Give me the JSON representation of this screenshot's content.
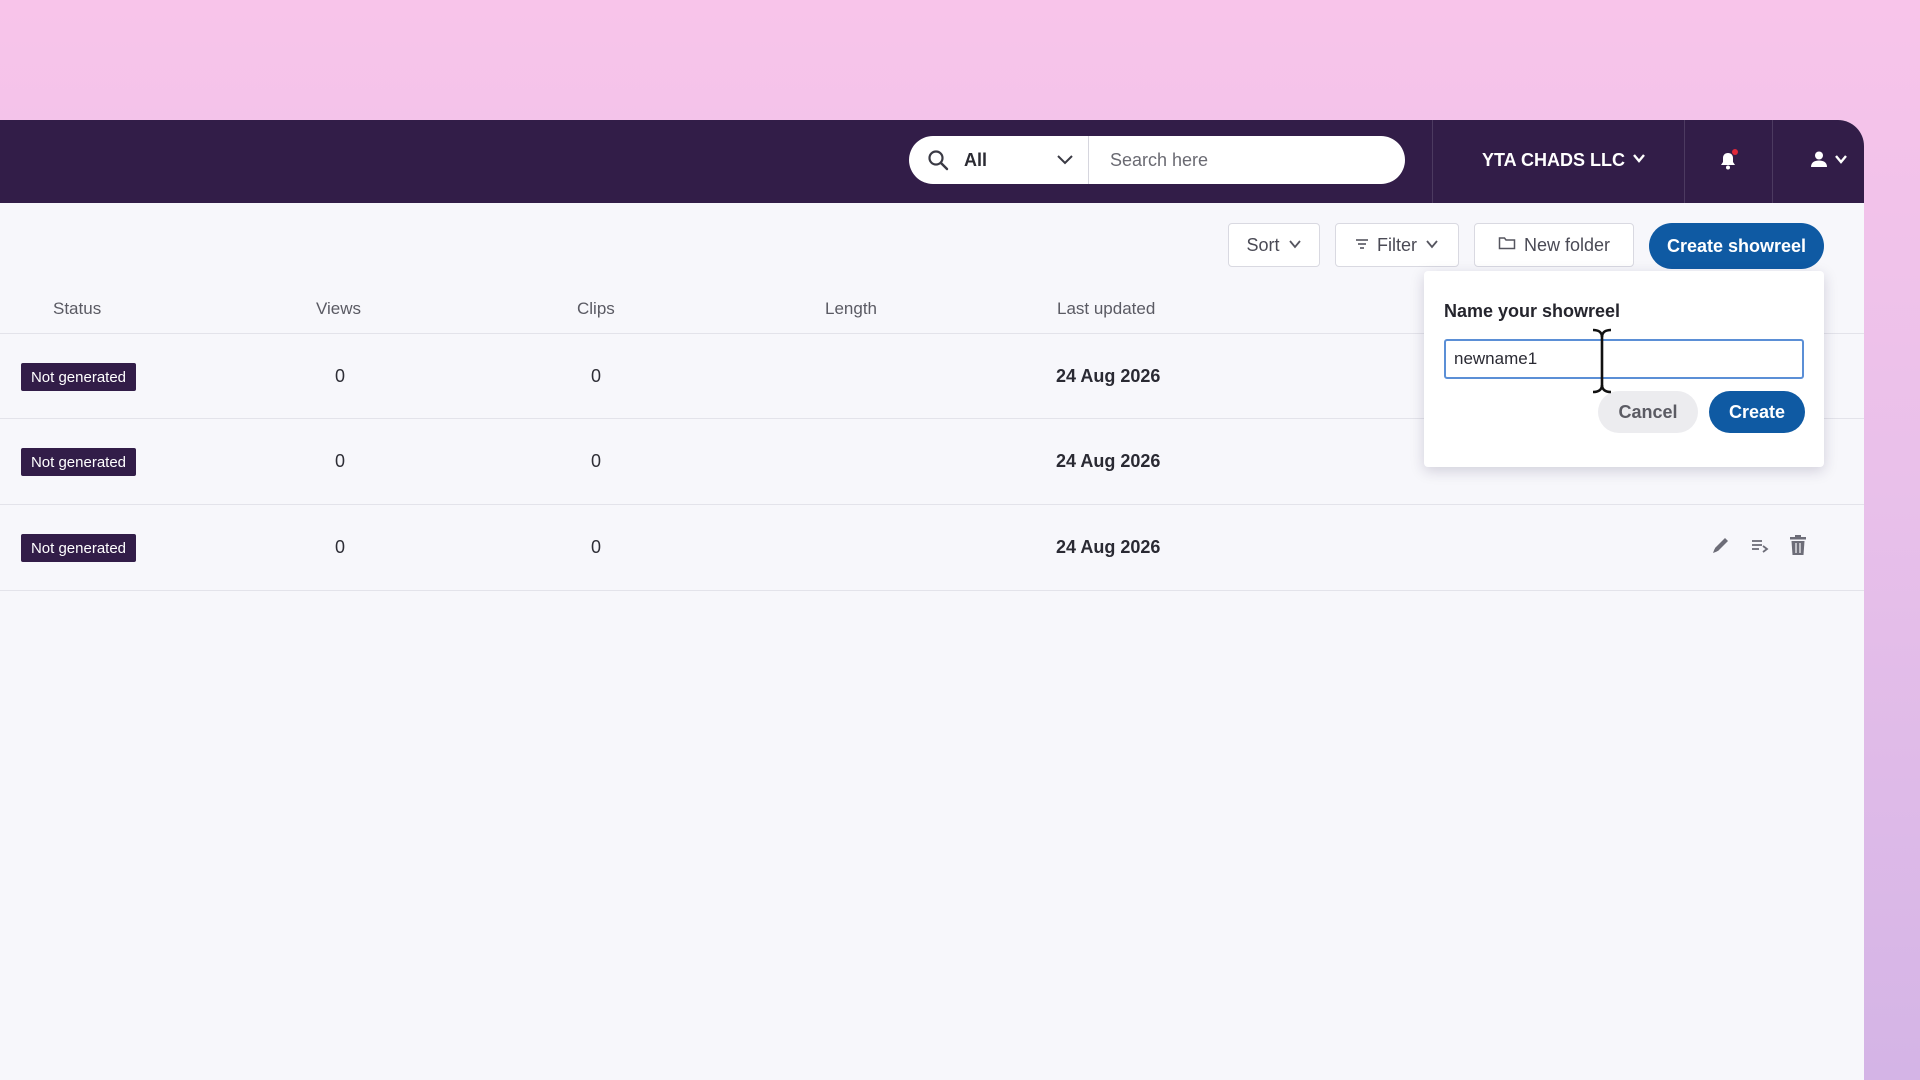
{
  "header": {
    "search_scope": "All",
    "search_placeholder": "Search here",
    "org_name": "YTA CHADS LLC",
    "icons": [
      "search-icon",
      "chevron-down-icon",
      "bell-icon",
      "user-icon"
    ]
  },
  "toolbar": {
    "sort_label": "Sort",
    "filter_label": "Filter",
    "new_folder_label": "New folder",
    "create_showreel_label": "Create showreel"
  },
  "table": {
    "columns": [
      "Status",
      "Views",
      "Clips",
      "Length",
      "Last updated"
    ],
    "rows": [
      {
        "status": "Not generated",
        "views": "0",
        "clips": "0",
        "length": "",
        "last_updated": "24 Aug 2026"
      },
      {
        "status": "Not generated",
        "views": "0",
        "clips": "0",
        "length": "",
        "last_updated": "24 Aug 2026"
      },
      {
        "status": "Not generated",
        "views": "0",
        "clips": "0",
        "length": "",
        "last_updated": "24 Aug 2026"
      }
    ],
    "row_actions": [
      "pencil-icon",
      "move-list-icon",
      "trash-icon"
    ]
  },
  "popover": {
    "title": "Name your showreel",
    "input_value": "newname1",
    "cancel_label": "Cancel",
    "create_label": "Create"
  },
  "colors": {
    "nav_bg": "#321d48",
    "primary": "#0f5aa3",
    "badge_bg": "#321d48",
    "notification_dot": "#e0283a"
  }
}
